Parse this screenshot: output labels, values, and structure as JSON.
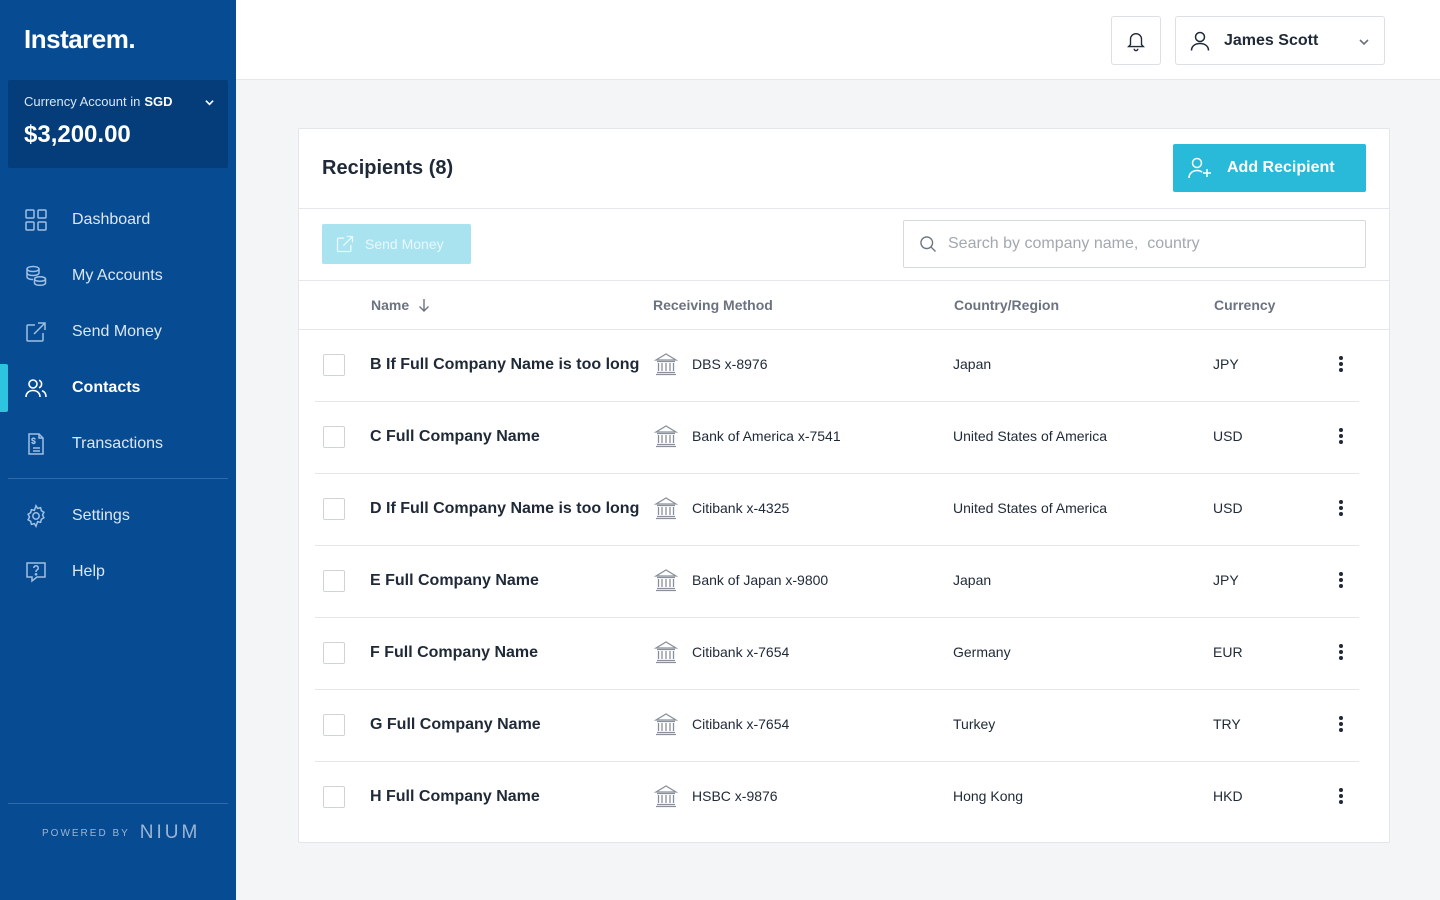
{
  "brand": {
    "logo": "Instarem."
  },
  "account": {
    "label": "Currency Account in",
    "currency": "SGD",
    "balance": "$3,200.00"
  },
  "nav": {
    "items": [
      {
        "label": "Dashboard",
        "icon": "grid-icon"
      },
      {
        "label": "My Accounts",
        "icon": "coins-icon"
      },
      {
        "label": "Send Money",
        "icon": "send-icon"
      },
      {
        "label": "Contacts",
        "icon": "contacts-icon",
        "active": true
      },
      {
        "label": "Transactions",
        "icon": "receipt-icon"
      }
    ],
    "secondary": [
      {
        "label": "Settings",
        "icon": "gear-icon"
      },
      {
        "label": "Help",
        "icon": "help-icon"
      }
    ]
  },
  "footer": {
    "powered_by": "POWERED BY",
    "partner": "NIUM"
  },
  "header": {
    "user_name": "James Scott"
  },
  "recipients": {
    "title": "Recipients (8)",
    "add_label": "Add Recipient",
    "send_label": "Send Money",
    "search_placeholder": "Search by company name,  country",
    "columns": {
      "name": "Name",
      "method": "Receiving Method",
      "country": "Country/Region",
      "currency": "Currency"
    },
    "rows": [
      {
        "name": "B If Full Company Name is too long",
        "method": "DBS x-8976",
        "country": "Japan",
        "currency": "JPY"
      },
      {
        "name": "C Full Company Name",
        "method": "Bank of America x-7541",
        "country": "United States of America",
        "currency": "USD"
      },
      {
        "name": "D If Full Company Name is too long",
        "method": "Citibank x-4325",
        "country": "United States of America",
        "currency": "USD"
      },
      {
        "name": "E Full Company Name",
        "method": "Bank of Japan x-9800",
        "country": "Japan",
        "currency": "JPY"
      },
      {
        "name": "F Full Company Name",
        "method": "Citibank x-7654",
        "country": "Germany",
        "currency": "EUR"
      },
      {
        "name": "G Full Company Name",
        "method": "Citibank x-7654",
        "country": "Turkey",
        "currency": "TRY"
      },
      {
        "name": "H Full Company Name",
        "method": "HSBC x-9876",
        "country": "Hong Kong",
        "currency": "HKD"
      }
    ]
  },
  "colors": {
    "sidebar": "#074b93",
    "accent": "#28bad8",
    "active_indicator": "#2ec4e0"
  }
}
